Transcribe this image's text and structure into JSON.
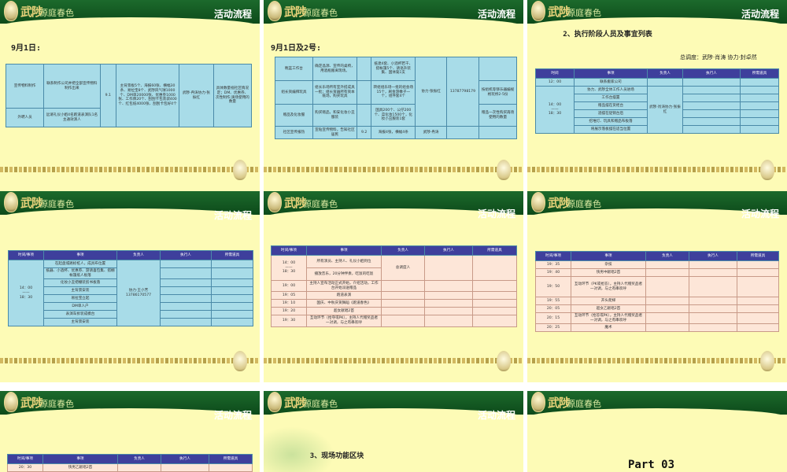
{
  "brand": {
    "logo_cn": "武陟",
    "logo_sub": "源庭春色"
  },
  "slides": [
    {
      "title": "活动流程",
      "heading": "9月1日:",
      "rows": [
        [
          "宣传物料制作",
          "联系制作公司并把全部宣传物料制作出来",
          "9.1",
          "主背景板5个、海报60张、横幅30条、易拉宝8个、武陟风气球1000个、DM单20000张、优惠券1000张、工作牌20个、刮刮卡包装袋400个、红包纸4000张、刮刮卡包好4个",
          "武陟·冉涛协力·张振红",
          "具体数量视社区情况定；DM、优惠券、次性制作;滴场使用的数量"
        ],
        [
          "外聘人员",
          "远请礼仪小姐4名跑道表演队1名主通效演人",
          "",
          "",
          "",
          ""
        ]
      ]
    },
    {
      "title": "活动流程",
      "heading": "9月1日及2号:",
      "rows": [
        [
          "晚篮工作台",
          "确定晶源、宣传的桌椅，用酒瓶搬离现场。",
          "",
          "抵達4套、小酒杯若干、搭帐篷5个、请语升装集、国体笼1支",
          "",
          "",
          ""
        ],
        [
          "组长资编拜玩具",
          "组长乐场所有室外搭成具一批；组长资器所有资本纸场，购买玩具",
          "",
          "转组组乐场一批的组会场15个，刷金游橡子一个，组件套4个",
          "协力·张振红",
          "13787798179",
          "按组机等够乐器编规格玩桥2-5份"
        ],
        [
          "赠品及化妆服",
          "购买赠品，和安化妆小丑服装",
          "",
          "国具200个、公仔200个、菜化妆1500个，化妆小丑服装1套",
          "",
          "",
          "赠品一次性购买再场使用的数量"
        ],
        [
          "社区宣传报热",
          "宣贴宣传物料，告知社区居民",
          "9.2",
          "海报4张，横幅4条",
          "武陟·冉涛",
          "",
          ""
        ]
      ]
    },
    {
      "title": "活动流程",
      "heading": "2、执行阶段人员及事宜列表",
      "note": "总调度：武陟·肖涛 协力·封卓然",
      "headers": [
        "时间",
        "事项",
        "负责人",
        "执行人",
        "所需道具"
      ],
      "times": [
        "12：00",
        "14：00\n——\n18：30"
      ],
      "tasks": [
        "联系搬家公司",
        "协力、武陟全体工作人员进场",
        "工作台摆置",
        "赠品摆在货柜台",
        "酒摆在促销台后",
        "挖堆灯、玩具和赠品布板落",
        "将展示落板摆在适当位置"
      ],
      "owner": "武陟·肖涛协力·张振红"
    },
    {
      "title": "活动流程",
      "headers": [
        "时间/事项",
        "事项",
        "负责人",
        "执行人",
        "所需道具"
      ],
      "time": "14：00\n——\n18：30",
      "tasks": [
        "在起盘城路标桩人，成具布位置",
        "抵器、小酒杯、优惠券、游请喜包集、搭棚帐篷纸人板落",
        "化妆小丑把棚装剪书板落",
        "主背景安装",
        "易拉宝立起",
        "DM单人户",
        "表演车拆装成模台",
        "主背景安装"
      ],
      "owner": "协力·王小芳13786170577"
    },
    {
      "title": "活动流程",
      "headers": [
        "时间/事项",
        "事项",
        "负责人",
        "执行人",
        "所需道具"
      ],
      "rows": [
        [
          "14：00\n——\n18：30",
          "所有演员、主持人、礼仪小姐到位"
        ],
        [
          "",
          "播放音乐，20分钟伴奏，吃饭的吃饭"
        ],
        [
          "19：00",
          "主持人宣布活动正式开始，介绍活动，工作台开始派送赠品"
        ],
        [
          "19：05",
          "跑道表演"
        ],
        [
          "19：10",
          "国庆、中秋庆贺舞蹈《跑道春色》"
        ],
        [
          "19：20",
          "超女献唱2首"
        ],
        [
          "19：30",
          "互动环节（抢夺或PK），主持人代赠奖品者一对调，与之有串欢呼"
        ]
      ],
      "owner": "总调度人"
    },
    {
      "title": "活动流程",
      "headers": [
        "时间/事项",
        "事项",
        "负责人",
        "执行人",
        "所需道具"
      ],
      "rows": [
        [
          "19：35",
          "杂技"
        ],
        [
          "19：40",
          "快男中献唱2首"
        ],
        [
          "19：50",
          "互动环节（PK或抢答），主持人代赠奖品者一对调，与之有串欢呼"
        ],
        [
          "19：55",
          "开头爬梯"
        ],
        [
          "20：05",
          "超女乙献唱2首"
        ],
        [
          "20：15",
          "互动环节（抢答或PK），主持人代赠奖品者一对调，与之有串欢呼"
        ],
        [
          "20：25",
          "魔术"
        ]
      ]
    },
    {
      "title": "活动流程",
      "headers": [
        "时间/事项",
        "事项",
        "负责人",
        "执行人",
        "所需道具"
      ],
      "rows": [
        [
          "20：30",
          "快男乙献唱2首"
        ]
      ]
    },
    {
      "title": "活动流程",
      "heading": "3、现场功能区块"
    },
    {
      "part": "Part 03"
    }
  ]
}
